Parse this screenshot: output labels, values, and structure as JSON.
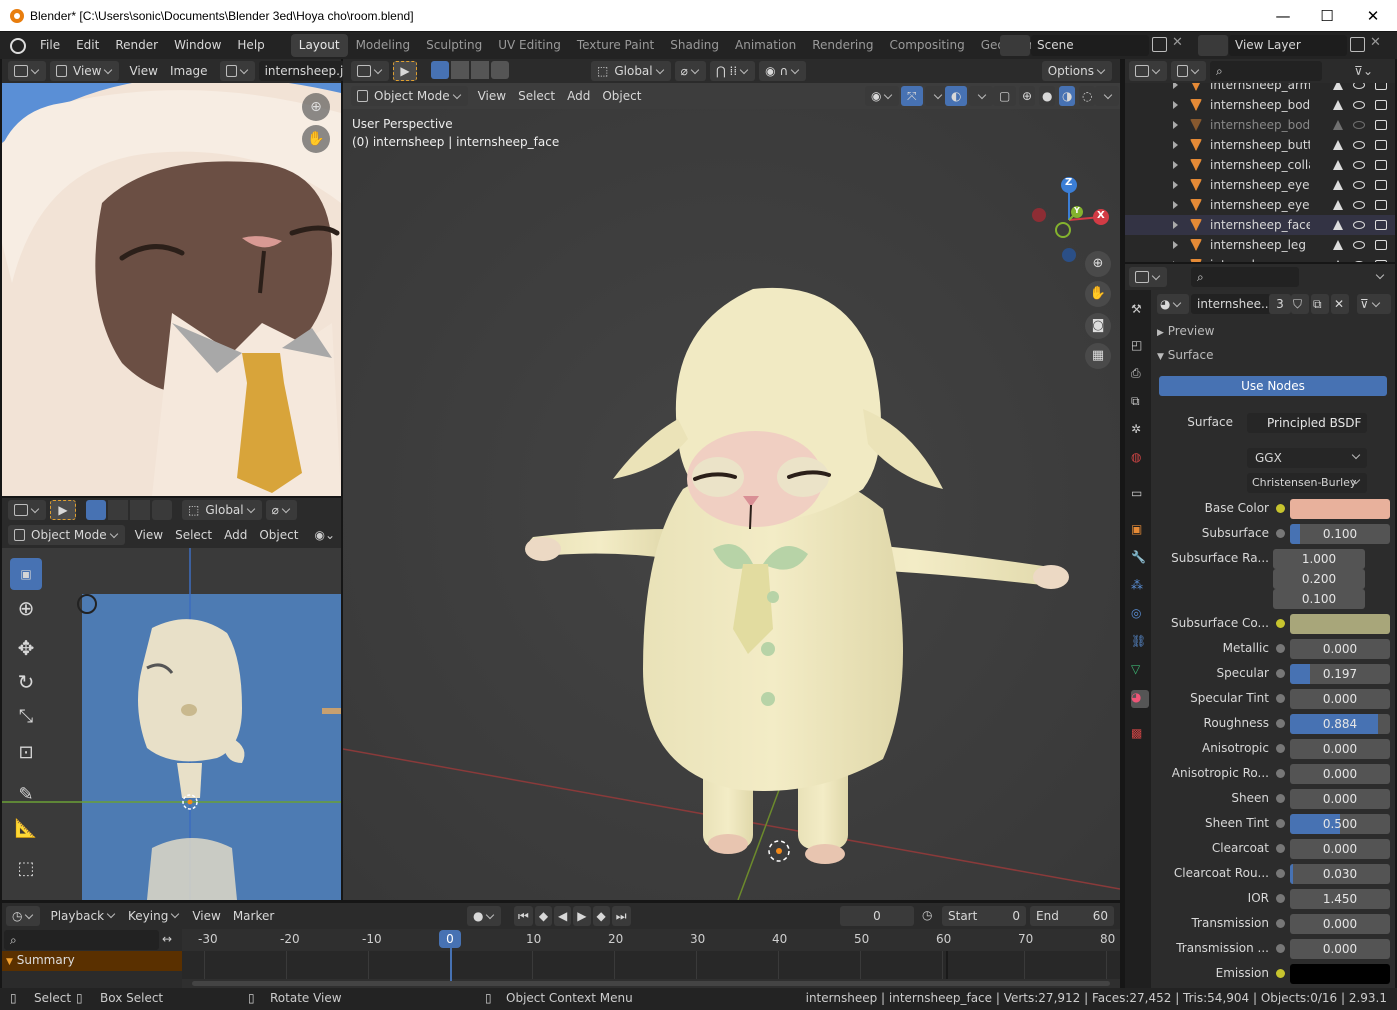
{
  "window": {
    "title": "Blender* [C:\\Users\\sonic\\Documents\\Blender 3ed\\Hoya cho\\room.blend]",
    "minimize": "—",
    "maximize": "☐",
    "close": "✕"
  },
  "menu": [
    "File",
    "Edit",
    "Render",
    "Window",
    "Help"
  ],
  "workspaces": [
    "Layout",
    "Modeling",
    "Sculpting",
    "UV Editing",
    "Texture Paint",
    "Shading",
    "Animation",
    "Rendering",
    "Compositing",
    "Geometry Nodes"
  ],
  "active_workspace": "Layout",
  "scene": {
    "name": "Scene",
    "view_layer": "View Layer"
  },
  "image_editor": {
    "view_menu": "View",
    "view2": "View",
    "image_menu": "Image",
    "image_name": "internsheep.jpg"
  },
  "viewport_header": {
    "transform": "Global",
    "options": "Options",
    "mode": "Object Mode",
    "menus": [
      "View",
      "Select",
      "Add",
      "Object"
    ]
  },
  "viewport": {
    "perspective": "User Perspective",
    "object_info": "(0) internsheep | internsheep_face",
    "axis_x": "X",
    "axis_y": "Y",
    "axis_z": "Z"
  },
  "side_viewport": {
    "transform": "Global",
    "mode": "Object Mode",
    "menus": [
      "View",
      "Select",
      "Add",
      "Object"
    ]
  },
  "outliner": {
    "items": [
      "internsheep_arm",
      "internsheep_body",
      "internsheep_body cc",
      "internsheep_button",
      "internsheep_collar",
      "internsheep_eyes_ba",
      "internsheep_eyes_lir",
      "internsheep_face",
      "internsheep_leg",
      "internsheep_mouth"
    ]
  },
  "material": {
    "name": "internshee...",
    "users": "3",
    "panel_preview": "Preview",
    "panel_surface": "Surface",
    "use_nodes": "Use Nodes",
    "surface_label": "Surface",
    "surface_shader": "Principled BSDF",
    "distribution": "GGX",
    "subsurface_method": "Christensen-Burley",
    "base_color_label": "Base Color",
    "base_color": "#e8b19c",
    "subsurface_color": "#a8a67a",
    "emission_color": "#000000",
    "subsurface_radius_label": "Subsurface Ra...",
    "subsurface_radius": [
      "1.000",
      "0.200",
      "0.100"
    ],
    "subsurface_color_label": "Subsurface Co...",
    "params": [
      {
        "label": "Subsurface",
        "value": "0.100",
        "fraction": 0.1
      },
      {
        "label": "Metallic",
        "value": "0.000",
        "fraction": 0
      },
      {
        "label": "Specular",
        "value": "0.197",
        "fraction": 0.197
      },
      {
        "label": "Specular Tint",
        "value": "0.000",
        "fraction": 0
      },
      {
        "label": "Roughness",
        "value": "0.884",
        "fraction": 0.884
      },
      {
        "label": "Anisotropic",
        "value": "0.000",
        "fraction": 0
      },
      {
        "label": "Anisotropic Ro...",
        "value": "0.000",
        "fraction": 0
      },
      {
        "label": "Sheen",
        "value": "0.000",
        "fraction": 0
      },
      {
        "label": "Sheen Tint",
        "value": "0.500",
        "fraction": 0.5
      },
      {
        "label": "Clearcoat",
        "value": "0.000",
        "fraction": 0
      },
      {
        "label": "Clearcoat Rou...",
        "value": "0.030",
        "fraction": 0.03
      },
      {
        "label": "IOR",
        "value": "1.450",
        "fraction": 0
      },
      {
        "label": "Transmission",
        "value": "0.000",
        "fraction": 0
      },
      {
        "label": "Transmission ...",
        "value": "0.000",
        "fraction": 0
      }
    ],
    "emission_label": "Emission"
  },
  "timeline": {
    "menus": [
      "Playback",
      "Keying",
      "View",
      "Marker"
    ],
    "current_frame": "0",
    "start_label": "Start",
    "start": "0",
    "end_label": "End",
    "end": "60",
    "summary": "Summary",
    "ticks": [
      "-30",
      "-20",
      "-10",
      "0",
      "10",
      "20",
      "30",
      "40",
      "50",
      "60",
      "70",
      "80"
    ],
    "playhead": "0"
  },
  "statusbar": {
    "select": "Select",
    "box_select": "Box Select",
    "rotate": "Rotate View",
    "context": "Object Context Menu",
    "stats": "internsheep | internsheep_face | Verts:27,912 | Faces:27,452 | Tris:54,904 | Objects:0/16 | 2.93.1"
  }
}
